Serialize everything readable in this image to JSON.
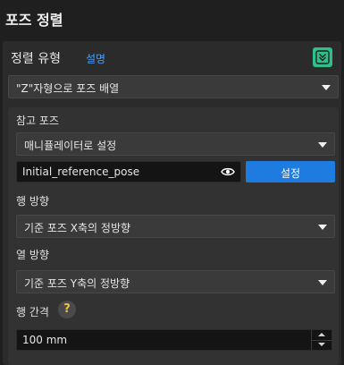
{
  "header": {
    "title": "포즈 정렬"
  },
  "section": {
    "label": "정렬 유형",
    "help_link": "설명",
    "sort_type_value": "\"Z\"자형으로 포즈 배열"
  },
  "reference_pose": {
    "label": "참고 포즈",
    "source_value": "매니퓰레이터로 설정",
    "pose_name": "Initial_reference_pose",
    "set_button": "설정"
  },
  "row_direction": {
    "label": "행 방향",
    "value": "기준 포즈 X축의 정방향"
  },
  "column_direction": {
    "label": "열 방향",
    "value": "기준 포즈 Y축의 정방향"
  },
  "row_spacing": {
    "label": "행 간격",
    "help_glyph": "?",
    "value": "100 mm"
  },
  "colors": {
    "accent_blue": "#1e7be0",
    "link_blue": "#4c9ef5",
    "collapse_green": "#2fc08a",
    "help_yellow": "#f0c040"
  }
}
